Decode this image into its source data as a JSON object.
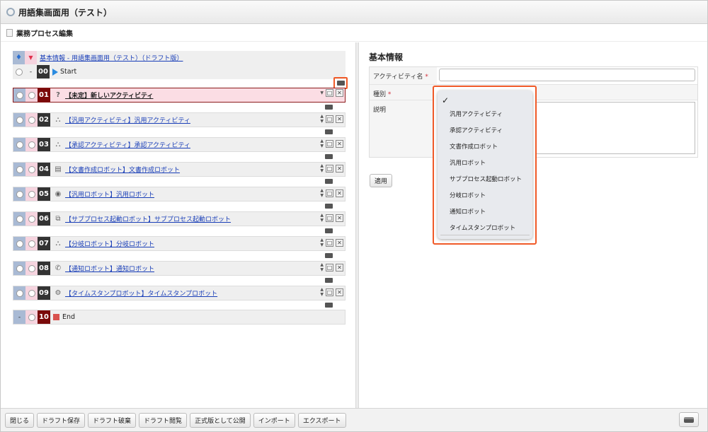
{
  "window": {
    "title": "用語集画面用（テスト）"
  },
  "page": {
    "subtitle": "業務プロセス編集"
  },
  "process": {
    "header_link": "基本情報 - 用語集画面用（テスト）（ドラフト版）",
    "start": {
      "number": "00",
      "label": "Start"
    },
    "end": {
      "number": "10",
      "label": "End"
    },
    "selected": {
      "number": "01",
      "label": "【未定】新しいアクティビティ"
    },
    "steps": [
      {
        "number": "02",
        "label": "【汎用アクティビティ】汎用アクティビティ",
        "icon": "org-chart-icon"
      },
      {
        "number": "03",
        "label": "【承認アクティビティ】承認アクティビティ",
        "icon": "approval-icon"
      },
      {
        "number": "04",
        "label": "【文書作成ロボット】文書作成ロボット",
        "icon": "document-icon"
      },
      {
        "number": "05",
        "label": "【汎用ロボット】汎用ロボット",
        "icon": "robot-icon"
      },
      {
        "number": "06",
        "label": "【サブプロセス起動ロボット】サブプロセス起動ロボット",
        "icon": "subprocess-icon"
      },
      {
        "number": "07",
        "label": "【分岐ロボット】分岐ロボット",
        "icon": "branch-icon"
      },
      {
        "number": "08",
        "label": "【通知ロボット】通知ロボット",
        "icon": "notify-icon"
      },
      {
        "number": "09",
        "label": "【タイムスタンプロボット】タイムスタンプロボット",
        "icon": "timestamp-icon"
      }
    ]
  },
  "detail": {
    "title": "基本情報",
    "activity_name_label": "アクティビティ名",
    "type_label": "種別",
    "description_label": "説明",
    "required_mark": "*",
    "apply_label": "適用"
  },
  "type_dropdown": {
    "check": "✓",
    "options": [
      "汎用アクティビティ",
      "承認アクティビティ",
      "文書作成ロボット",
      "汎用ロボット",
      "サブプロセス起動ロボット",
      "分岐ロボット",
      "通知ロボット",
      "タイムスタンプロボット"
    ]
  },
  "toolbar": {
    "close": "閉じる",
    "save_draft": "ドラフト保存",
    "discard_draft": "ドラフト破棄",
    "view_draft": "ドラフト閲覧",
    "publish": "正式版として公開",
    "import": "インポート",
    "export": "エクスポート"
  },
  "colors": {
    "highlight": "#f05a28",
    "selected_row": "#fbdde4",
    "link": "#1a3fb8"
  }
}
